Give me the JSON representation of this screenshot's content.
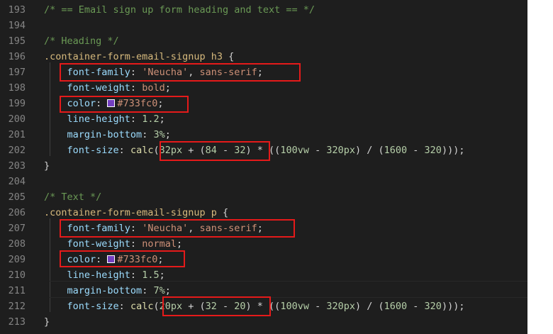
{
  "editor": {
    "accent_red": "#e51a1a",
    "swatch_color": "#733fc0",
    "lines": [
      {
        "num": "193",
        "tokens": [
          {
            "t": "/* == Email sign up form heading and text == */",
            "c": "comment"
          }
        ]
      },
      {
        "num": "194",
        "tokens": []
      },
      {
        "num": "195",
        "tokens": [
          {
            "t": "/* Heading */",
            "c": "comment"
          }
        ]
      },
      {
        "num": "196",
        "tokens": [
          {
            "t": ".container-form-email-signup h3",
            "c": "selector"
          },
          {
            "t": " {",
            "c": "punct"
          }
        ]
      },
      {
        "num": "197",
        "tokens": [
          {
            "t": "    ",
            "c": "punct"
          },
          {
            "t": "font-family",
            "c": "prop"
          },
          {
            "t": ": ",
            "c": "punct"
          },
          {
            "t": "'Neucha'",
            "c": "str"
          },
          {
            "t": ", ",
            "c": "punct"
          },
          {
            "t": "sans-serif",
            "c": "val"
          },
          {
            "t": ";",
            "c": "punct"
          }
        ]
      },
      {
        "num": "198",
        "tokens": [
          {
            "t": "    ",
            "c": "punct"
          },
          {
            "t": "font-weight",
            "c": "prop"
          },
          {
            "t": ": ",
            "c": "punct"
          },
          {
            "t": "bold",
            "c": "val"
          },
          {
            "t": ";",
            "c": "punct"
          }
        ]
      },
      {
        "num": "199",
        "tokens": [
          {
            "t": "    ",
            "c": "punct"
          },
          {
            "t": "color",
            "c": "prop"
          },
          {
            "t": ": ",
            "c": "punct"
          },
          {
            "t": "",
            "c": "swatch"
          },
          {
            "t": "#733fc0",
            "c": "val"
          },
          {
            "t": ";",
            "c": "punct"
          }
        ]
      },
      {
        "num": "200",
        "tokens": [
          {
            "t": "    ",
            "c": "punct"
          },
          {
            "t": "line-height",
            "c": "prop"
          },
          {
            "t": ": ",
            "c": "punct"
          },
          {
            "t": "1.2",
            "c": "num"
          },
          {
            "t": ";",
            "c": "punct"
          }
        ]
      },
      {
        "num": "201",
        "tokens": [
          {
            "t": "    ",
            "c": "punct"
          },
          {
            "t": "margin-bottom",
            "c": "prop"
          },
          {
            "t": ": ",
            "c": "punct"
          },
          {
            "t": "3%",
            "c": "num"
          },
          {
            "t": ";",
            "c": "punct"
          }
        ]
      },
      {
        "num": "202",
        "tokens": [
          {
            "t": "    ",
            "c": "punct"
          },
          {
            "t": "font-size",
            "c": "prop"
          },
          {
            "t": ": ",
            "c": "punct"
          },
          {
            "t": "calc",
            "c": "func"
          },
          {
            "t": "(",
            "c": "punct"
          },
          {
            "t": "32px",
            "c": "num"
          },
          {
            "t": " + (",
            "c": "punct"
          },
          {
            "t": "84",
            "c": "num"
          },
          {
            "t": " - ",
            "c": "punct"
          },
          {
            "t": "32",
            "c": "num"
          },
          {
            "t": ") * ((",
            "c": "punct"
          },
          {
            "t": "100vw",
            "c": "num"
          },
          {
            "t": " - ",
            "c": "punct"
          },
          {
            "t": "320px",
            "c": "num"
          },
          {
            "t": ") / (",
            "c": "punct"
          },
          {
            "t": "1600",
            "c": "num"
          },
          {
            "t": " - ",
            "c": "punct"
          },
          {
            "t": "320",
            "c": "num"
          },
          {
            "t": ")));",
            "c": "punct"
          }
        ]
      },
      {
        "num": "203",
        "tokens": [
          {
            "t": "}",
            "c": "punct"
          }
        ]
      },
      {
        "num": "204",
        "tokens": []
      },
      {
        "num": "205",
        "tokens": [
          {
            "t": "/* Text */",
            "c": "comment"
          }
        ]
      },
      {
        "num": "206",
        "tokens": [
          {
            "t": ".container-form-email-signup p",
            "c": "selector"
          },
          {
            "t": " {",
            "c": "punct"
          }
        ]
      },
      {
        "num": "207",
        "tokens": [
          {
            "t": "    ",
            "c": "punct"
          },
          {
            "t": "font-family",
            "c": "prop"
          },
          {
            "t": ": ",
            "c": "punct"
          },
          {
            "t": "'Neucha'",
            "c": "str"
          },
          {
            "t": ", ",
            "c": "punct"
          },
          {
            "t": "sans-serif",
            "c": "val"
          },
          {
            "t": ";",
            "c": "punct"
          }
        ]
      },
      {
        "num": "208",
        "tokens": [
          {
            "t": "    ",
            "c": "punct"
          },
          {
            "t": "font-weight",
            "c": "prop"
          },
          {
            "t": ": ",
            "c": "punct"
          },
          {
            "t": "normal",
            "c": "val"
          },
          {
            "t": ";",
            "c": "punct"
          }
        ]
      },
      {
        "num": "209",
        "tokens": [
          {
            "t": "    ",
            "c": "punct"
          },
          {
            "t": "color",
            "c": "prop"
          },
          {
            "t": ": ",
            "c": "punct"
          },
          {
            "t": "",
            "c": "swatch"
          },
          {
            "t": "#733fc0",
            "c": "val"
          },
          {
            "t": ";",
            "c": "punct"
          }
        ]
      },
      {
        "num": "210",
        "tokens": [
          {
            "t": "    ",
            "c": "punct"
          },
          {
            "t": "line-height",
            "c": "prop"
          },
          {
            "t": ": ",
            "c": "punct"
          },
          {
            "t": "1.5",
            "c": "num"
          },
          {
            "t": ";",
            "c": "punct"
          }
        ]
      },
      {
        "num": "211",
        "tokens": [
          {
            "t": "    ",
            "c": "punct"
          },
          {
            "t": "margin-bottom",
            "c": "prop"
          },
          {
            "t": ": ",
            "c": "punct"
          },
          {
            "t": "7%",
            "c": "num"
          },
          {
            "t": ";",
            "c": "punct"
          }
        ]
      },
      {
        "num": "212",
        "tokens": [
          {
            "t": "    ",
            "c": "punct"
          },
          {
            "t": "font-size",
            "c": "prop"
          },
          {
            "t": ": ",
            "c": "punct"
          },
          {
            "t": "calc",
            "c": "func"
          },
          {
            "t": "(",
            "c": "punct"
          },
          {
            "t": "20px",
            "c": "num"
          },
          {
            "t": " + (",
            "c": "punct"
          },
          {
            "t": "32",
            "c": "num"
          },
          {
            "t": " - ",
            "c": "punct"
          },
          {
            "t": "20",
            "c": "num"
          },
          {
            "t": ") * ((",
            "c": "punct"
          },
          {
            "t": "100vw",
            "c": "num"
          },
          {
            "t": " - ",
            "c": "punct"
          },
          {
            "t": "320px",
            "c": "num"
          },
          {
            "t": ") / (",
            "c": "punct"
          },
          {
            "t": "1600",
            "c": "num"
          },
          {
            "t": " - ",
            "c": "punct"
          },
          {
            "t": "320",
            "c": "num"
          },
          {
            "t": ")));",
            "c": "punct"
          }
        ]
      },
      {
        "num": "213",
        "tokens": [
          {
            "t": "}",
            "c": "punct"
          }
        ]
      }
    ]
  }
}
